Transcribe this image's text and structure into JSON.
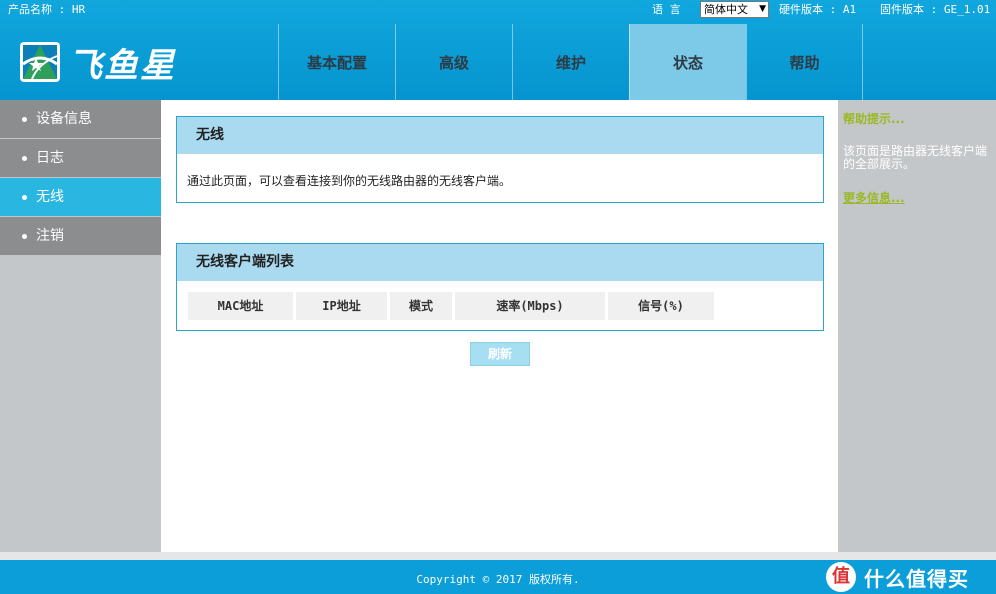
{
  "header": {
    "product_name": "产品名称 : HR",
    "language_label": "语  言",
    "language_value": "简体中文",
    "hardware_version": "硬件版本 : A1",
    "firmware_version": "固件版本 : GE_1.01",
    "logo_text": "飞鱼星",
    "nav": [
      {
        "label": "基本配置"
      },
      {
        "label": "高级"
      },
      {
        "label": "维护"
      },
      {
        "label": "状态",
        "active": true
      },
      {
        "label": "帮助"
      }
    ]
  },
  "sidebar": {
    "items": [
      {
        "label": "设备信息"
      },
      {
        "label": "日志"
      },
      {
        "label": "无线",
        "active": true
      },
      {
        "label": "注销"
      }
    ]
  },
  "main": {
    "wireless_panel": {
      "title": "无线",
      "description": "通过此页面，可以查看连接到你的无线路由器的无线客户端。"
    },
    "client_panel": {
      "title": "无线客户端列表",
      "columns": [
        "MAC地址",
        "IP地址",
        "模式",
        "速率(Mbps)",
        "信号(%)"
      ]
    },
    "refresh_label": "刷新"
  },
  "help": {
    "title": "帮助提示...",
    "text": "该页面是路由器无线客户端的全部展示。",
    "more": "更多信息..."
  },
  "footer": {
    "copyright": "Copyright © 2017 版权所有.",
    "watermark_badge": "值",
    "watermark_text": "什么值得买"
  },
  "colors": {
    "header_blue": "#0b9ed8",
    "active_nav": "#7cc9e8",
    "active_side": "#29b6e1",
    "panel_head": "#a9daef",
    "help_link": "#9ab924"
  }
}
